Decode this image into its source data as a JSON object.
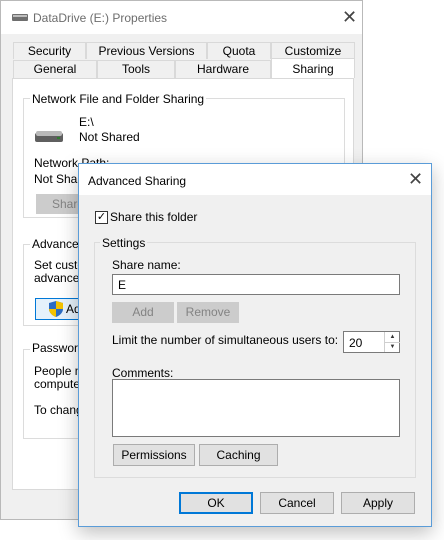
{
  "props_window": {
    "title": "DataDrive (E:) Properties",
    "close_glyph": "✕",
    "tabs_top": [
      "Security",
      "Previous Versions",
      "Quota",
      "Customize"
    ],
    "tabs_bottom": [
      "General",
      "Tools",
      "Hardware",
      "Sharing"
    ],
    "active_tab": "Sharing",
    "network_sharing": {
      "group_label": "Network File and Folder Sharing",
      "path": "E:\\",
      "status": "Not Shared",
      "network_path_label": "Network Path:",
      "network_path_value": "Not Share",
      "share_button": "Share"
    },
    "advanced_sharing": {
      "group_label": "Advanced",
      "text_line1": "Set custo",
      "text_line2": "advanced",
      "button": "Ad"
    },
    "password": {
      "group_label": "Password",
      "text_line1": "People mu",
      "text_line2": "computer",
      "text_line3": "To chang"
    }
  },
  "dialog": {
    "title": "Advanced Sharing",
    "close_glyph": "✕",
    "share_folder_label": "Share this folder",
    "share_folder_checked": true,
    "check_glyph": "✓",
    "settings_label": "Settings",
    "share_name_label": "Share name:",
    "share_name_value": "E",
    "add_button": "Add",
    "remove_button": "Remove",
    "limit_label": "Limit the number of simultaneous users to:",
    "limit_value": "20",
    "spin_up": "▲",
    "spin_down": "▼",
    "comments_label": "Comments:",
    "comments_value": "",
    "permissions_button": "Permissions",
    "caching_button": "Caching",
    "ok_button": "OK",
    "cancel_button": "Cancel",
    "apply_button": "Apply"
  },
  "colors": {
    "accent": "#0078d7",
    "dialog_border": "#5a9cd8",
    "disabled_button": "#cccccc",
    "window_bg": "#f0f0f0"
  }
}
